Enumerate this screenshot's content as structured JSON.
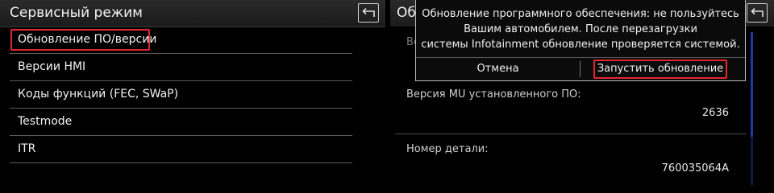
{
  "left_panel": {
    "title": "Сервисный режим",
    "back_icon": "back-arrow-icon",
    "menu": [
      {
        "label": "Обновление ПО/версии",
        "selected": true
      },
      {
        "label": "Версии HMI"
      },
      {
        "label": "Коды функций (FEC, SWaP)"
      },
      {
        "label": "Testmode"
      },
      {
        "label": "ITR"
      }
    ]
  },
  "right_panel": {
    "title": "Об",
    "partial_label": "Ве",
    "back_icon": "back-arrow-icon",
    "fields": [
      {
        "label": "Версия MU установленного ПО:",
        "value": "2636"
      },
      {
        "label": "Номер детали:",
        "value": "760035064A"
      }
    ]
  },
  "popup": {
    "message_lines": [
      "Обновление программного обеспечения: не пользуйтесь",
      "Вашим автомобилем. После перезагрузки",
      "системы Infotainment обновление проверяется системой."
    ],
    "cancel_label": "Отмена",
    "start_label": "Запустить обновление"
  },
  "colors": {
    "highlight": "#e3262f",
    "scrollbar": "#1e3aa8"
  }
}
